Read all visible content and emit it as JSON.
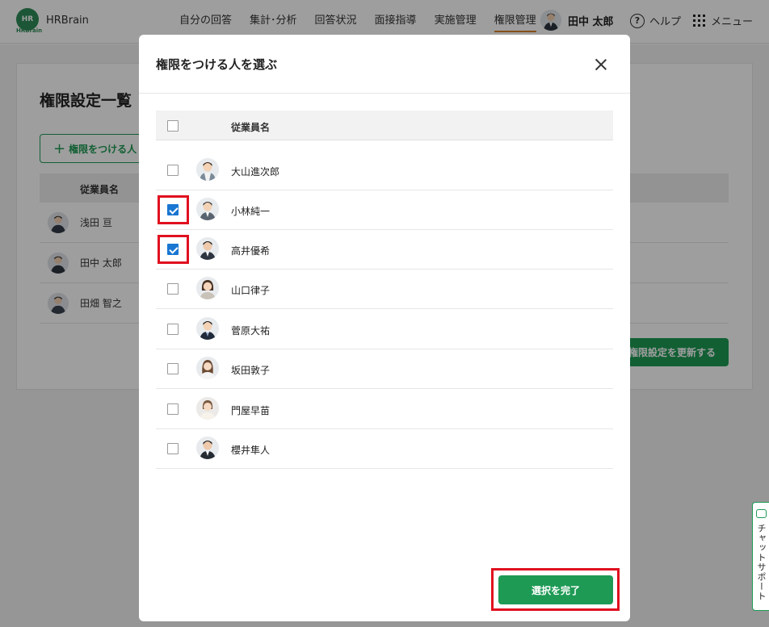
{
  "header": {
    "logo_mark": "HR",
    "logo_sub": "HRBrain",
    "logo_text": "HRBrain",
    "nav": [
      "自分の回答",
      "集計･分析",
      "回答状況",
      "面接指導",
      "実施管理",
      "権限管理"
    ],
    "active_nav": "権限管理",
    "user_name": "田中 太郎",
    "help_label": "ヘルプ",
    "menu_label": "メニュー"
  },
  "page": {
    "title": "権限設定一覧",
    "add_button_label": "権限をつける人",
    "table_header_name": "従業員名",
    "rows": [
      "浅田 亘",
      "田中 太郎",
      "田畑 智之"
    ],
    "update_button_label": "権限設定を更新する"
  },
  "modal": {
    "title": "権限をつける人を選ぶ",
    "column_name": "従業員名",
    "employees": [
      {
        "name": "大山進次郎",
        "checked": false,
        "avatar": "male-short"
      },
      {
        "name": "小林純一",
        "checked": true,
        "avatar": "male-suit"
      },
      {
        "name": "高井優希",
        "checked": true,
        "avatar": "male-dark"
      },
      {
        "name": "山口律子",
        "checked": false,
        "avatar": "female-bob"
      },
      {
        "name": "菅原大祐",
        "checked": false,
        "avatar": "male-suit"
      },
      {
        "name": "坂田敦子",
        "checked": false,
        "avatar": "female-long"
      },
      {
        "name": "門屋早苗",
        "checked": false,
        "avatar": "female-short"
      },
      {
        "name": "櫻井隼人",
        "checked": false,
        "avatar": "male-dark"
      }
    ],
    "done_button_label": "選択を完了"
  },
  "chat": {
    "label": "チャットサポート"
  },
  "colors": {
    "brand_green": "#1e9a55",
    "checkbox_blue": "#1976d2",
    "highlight_red": "#e0101f"
  }
}
